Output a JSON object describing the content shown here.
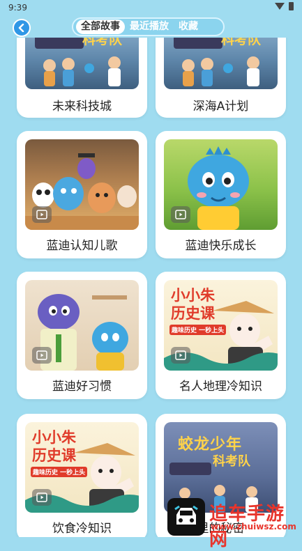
{
  "status_bar": {
    "time": "9:39"
  },
  "header": {
    "tabs": [
      {
        "label": "全部故事",
        "active": true
      },
      {
        "label": "最近播放",
        "active": false
      },
      {
        "label": "收藏",
        "active": false
      }
    ]
  },
  "stories": [
    {
      "title": "未来科技城"
    },
    {
      "title": "深海A计划"
    },
    {
      "title": "蓝迪认知儿歌"
    },
    {
      "title": "蓝迪快乐成长"
    },
    {
      "title": "蓝迪好习惯"
    },
    {
      "title": "名人地理冷知识"
    },
    {
      "title": "饮食冷知识"
    },
    {
      "title": "里的秘密"
    }
  ],
  "thumb_texts": {
    "keji": "科考队",
    "history_line1": "小小朱",
    "history_line2": "历史课",
    "history_sub": "趣味历史 一秒上头",
    "jiaolong_line1": "蛟龙少年",
    "jiaolong_line2": "科考队"
  },
  "watermark": {
    "text": "追车手游网",
    "url": "www.zhuiwsz.com"
  },
  "colors": {
    "accent": "#2f97e6",
    "background": "#9fdcf0"
  }
}
